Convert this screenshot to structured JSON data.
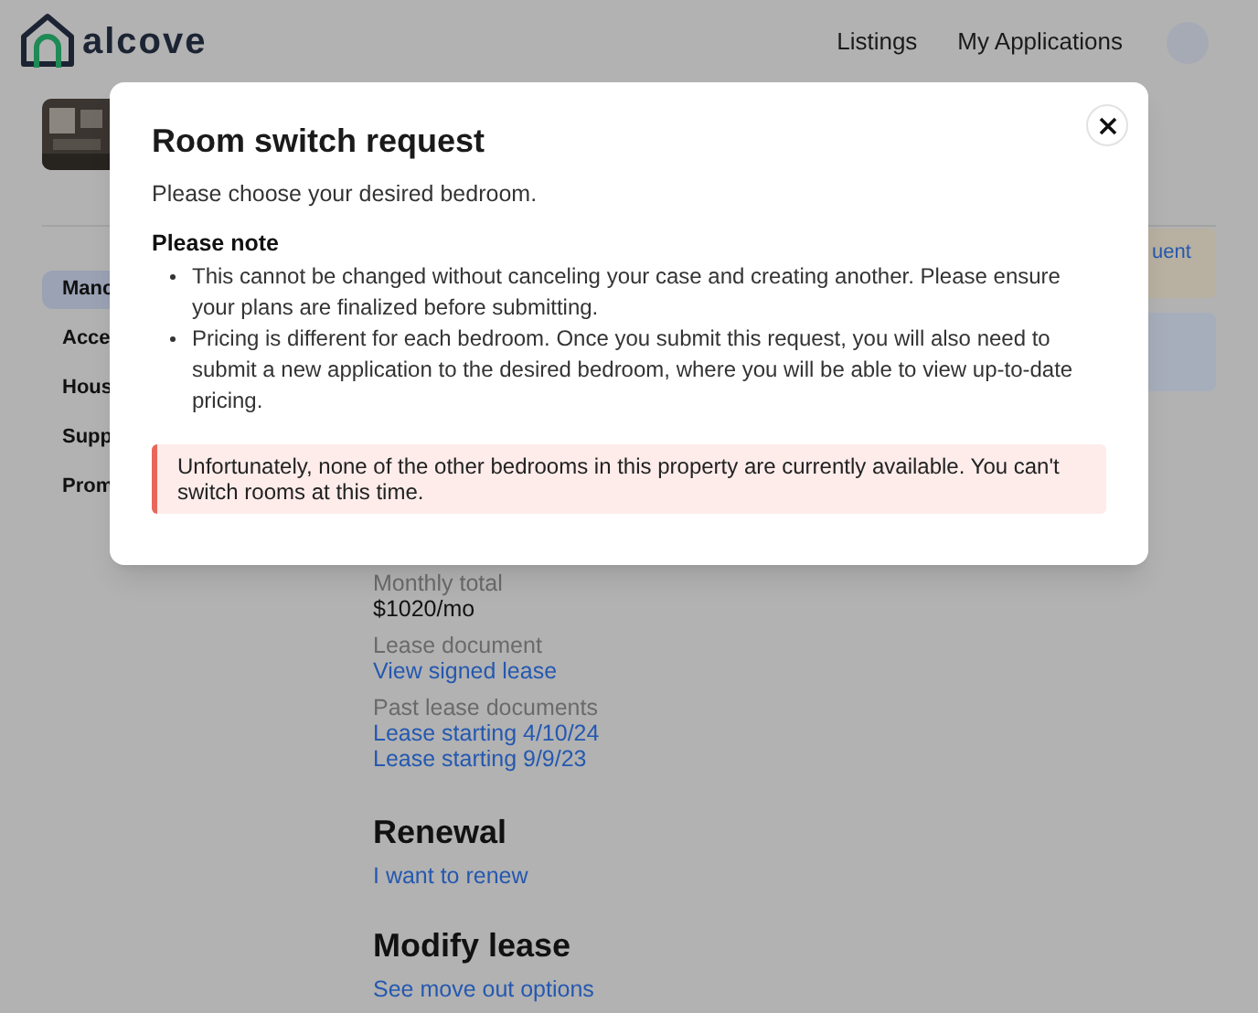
{
  "header": {
    "logo": "alcove",
    "nav": [
      {
        "label": "Listings"
      },
      {
        "label": "My Applications"
      }
    ]
  },
  "sidebar": {
    "items": [
      {
        "label": "Manc",
        "selected": true
      },
      {
        "label": "Acce",
        "selected": false
      },
      {
        "label": "Hous",
        "selected": false
      },
      {
        "label": "Supp",
        "selected": false
      },
      {
        "label": "Prom",
        "selected": false
      }
    ]
  },
  "side_cards": [
    {
      "kind": "notice",
      "link": "uent"
    },
    {
      "kind": "info"
    }
  ],
  "lease": {
    "monthly_total_label": "Monthly total",
    "monthly_total": "$1020/mo",
    "lease_document_label": "Lease document",
    "lease_document_link": "View signed lease",
    "past_label": "Past lease documents",
    "past_links": [
      "Lease starting 4/10/24",
      "Lease starting 9/9/23"
    ]
  },
  "renewal": {
    "title": "Renewal",
    "link": "I want to renew"
  },
  "modify": {
    "title": "Modify lease",
    "link": "See move out options"
  },
  "modal": {
    "title": "Room switch request",
    "intro": "Please choose your desired bedroom.",
    "note_title": "Please note",
    "notes": [
      "This cannot be changed without canceling your case and creating another. Please ensure your plans are finalized before submitting.",
      "Pricing is different for each bedroom. Once you submit this request, you will also need to submit a new application to the desired bedroom, where you will be able to view up-to-date pricing."
    ],
    "alert": "Unfortunately, none of the other bedrooms in this property are currently available. You can't switch rooms at this time."
  }
}
